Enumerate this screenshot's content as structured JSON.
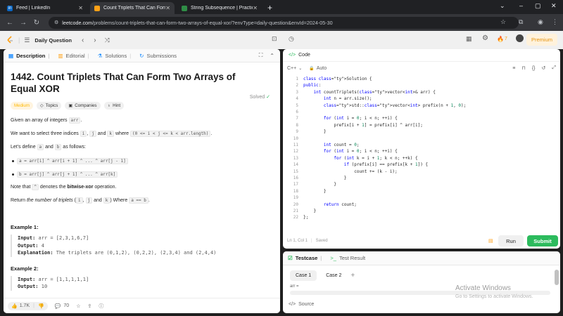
{
  "browser": {
    "tabs": [
      {
        "title": "Feed | LinkedIn",
        "icon": "linkedin-icon"
      },
      {
        "title": "Count Triplets That Can Form T",
        "icon": "leetcode-icon"
      },
      {
        "title": "String Subsequence | Practice |",
        "icon": "gfg-icon"
      }
    ],
    "url_host": "leetcode.com",
    "url_path": "/problems/count-triplets-that-can-form-two-arrays-of-equal-xor/?envType=daily-question&envId=2024-05-30"
  },
  "header": {
    "daily": "Daily Question",
    "streak": "7",
    "premium": "Premium"
  },
  "left_tabs": [
    "Description",
    "Editorial",
    "Solutions",
    "Submissions"
  ],
  "problem": {
    "title": "1442. Count Triplets That Can Form Two Arrays of Equal XOR",
    "solved": "Solved",
    "difficulty": "Medium",
    "chips": [
      "Topics",
      "Companies",
      "Hint"
    ],
    "p1a": "Given an array of integers ",
    "p1code": "arr",
    "p1b": ".",
    "p2a": "We want to select three indices ",
    "p2i": "i",
    "p2and1": ", ",
    "p2j": "j",
    "p2and2": " and ",
    "p2k": "k",
    "p2where": " where ",
    "p2cond": "(0 <= i < j <= k < arr.length)",
    "p2end": ".",
    "p3a": "Let's define ",
    "p3a2": "a",
    "p3and": " and ",
    "p3b2": "b",
    "p3end": " as follows:",
    "b1": "a = arr[i] ^ arr[i + 1] ^ ... ^ arr[j - 1]",
    "b2": "b = arr[j] ^ arr[j + 1] ^ ... ^ arr[k]",
    "p4a": "Note that ",
    "p4b": "^",
    "p4c": " denotes the ",
    "p4d": "bitwise-xor",
    "p4e": " operation.",
    "p5a": "Return ",
    "p5b": "the number of triplets",
    "p5c": " (",
    "p5i": "i",
    "p5d": ", ",
    "p5j": "j",
    "p5e": " and ",
    "p5k": "k",
    "p5f": ") Where ",
    "p5eq": "a == b",
    "p5g": "."
  },
  "examples": [
    {
      "header": "Example 1:",
      "input_label": "Input:",
      "input": " arr = [2,3,1,6,7]",
      "output_label": "Output:",
      "output": " 4",
      "expl_label": "Explanation:",
      "expl": " The triplets are (0,1,2), (0,2,2), (2,3,4) and (2,4,4)"
    },
    {
      "header": "Example 2:",
      "input_label": "Input:",
      "input": " arr = [1,1,1,1,1]",
      "output_label": "Output:",
      "output": " 10"
    }
  ],
  "left_footer": {
    "likes": "1.7K",
    "comments": "70"
  },
  "editor": {
    "title": "Code",
    "language": "C++",
    "mode": "Auto",
    "lines": [
      "class Solution {",
      "public:",
      "    int countTriplets(vector<int>& arr) {",
      "        int n = arr.size();",
      "        std::vector<int> prefix(n + 1, 0);",
      "",
      "        for (int i = 0; i < n; ++i) {",
      "            prefix[i + 1] = prefix[i] ^ arr[i];",
      "        }",
      "",
      "        int count = 0;",
      "        for (int i = 0; i < n; ++i) {",
      "            for (int k = i + 1; k < n; ++k) {",
      "                if (prefix[i] == prefix[k + 1]) {",
      "                    count += (k - i);",
      "                }",
      "            }",
      "        }",
      "",
      "        return count;",
      "    }",
      "};"
    ],
    "status_pos": "Ln 1, Col 1",
    "status_saved": "Saved",
    "run": "Run",
    "submit": "Submit"
  },
  "testpanel": {
    "tabs": [
      "Testcase",
      "Test Result"
    ],
    "cases": [
      "Case 1",
      "Case 2"
    ],
    "field_label": "arr =",
    "source": "Source"
  },
  "watermark": {
    "line1": "Activate Windows",
    "line2": "Go to Settings to activate Windows."
  },
  "colors": {
    "accent": "#ffa116",
    "submit": "#2cbb5d",
    "medium": "#ffb800"
  }
}
